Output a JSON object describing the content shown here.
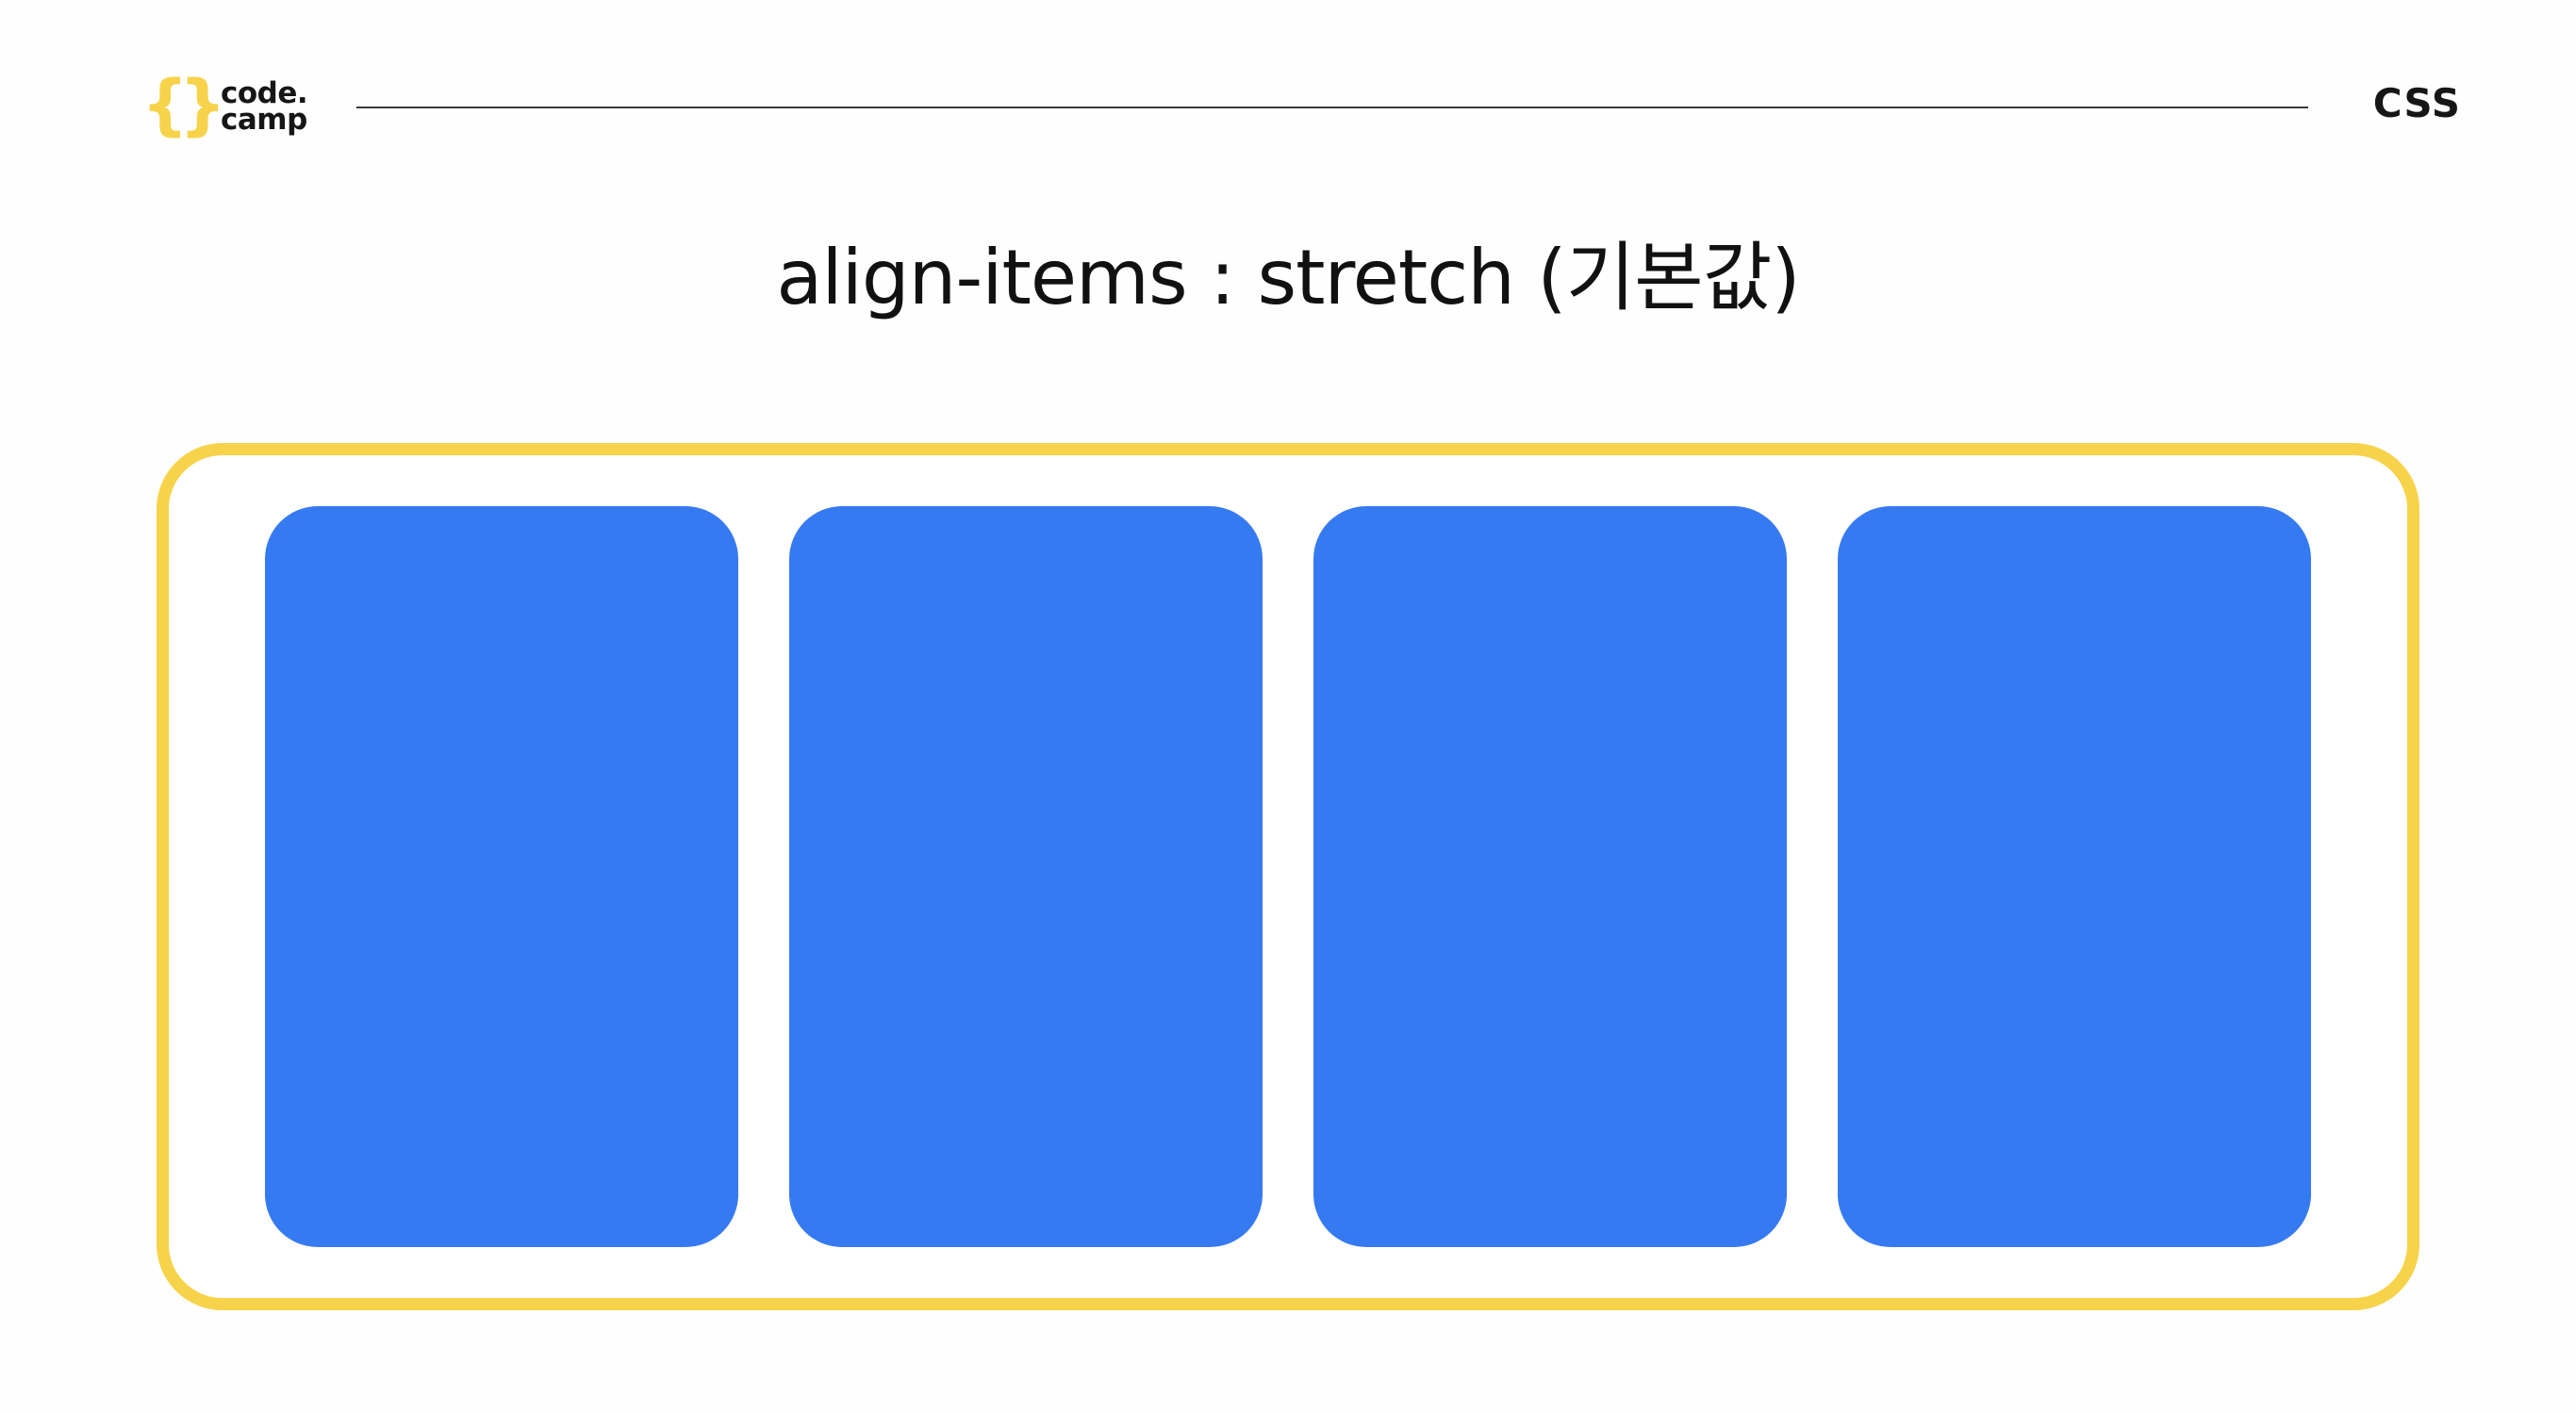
{
  "logo": {
    "bracket_left": "{",
    "bracket_right": "}",
    "line1": "code.",
    "line2": "camp",
    "accent_color": "#f7d34b"
  },
  "header": {
    "course": "CSS"
  },
  "title": "align-items : stretch (기본값)",
  "demo": {
    "container_border_color": "#f7d34b",
    "item_color": "#367af2",
    "item_count": 4
  }
}
